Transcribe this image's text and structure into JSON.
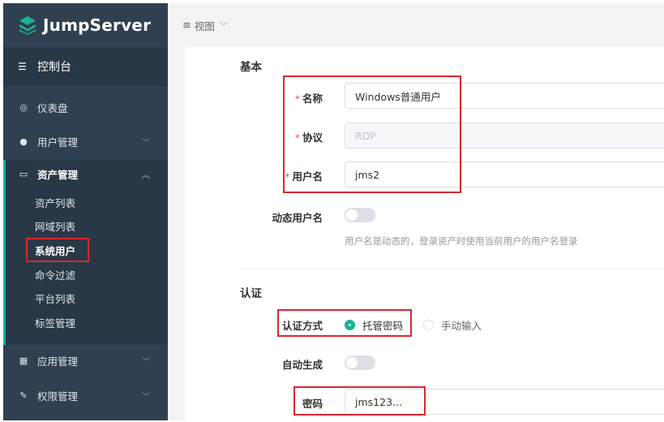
{
  "brand": {
    "name": "JumpServer",
    "accent": "#1ab394",
    "sidebar_bg": "#2f4050",
    "highlight": "#d9282f"
  },
  "sidebar": {
    "console_label": "控制台",
    "items": [
      {
        "label": "仪表盘",
        "icon": "dashboard-icon"
      },
      {
        "label": "用户管理",
        "icon": "users-icon"
      },
      {
        "label": "资产管理",
        "icon": "inbox-icon"
      },
      {
        "label": "应用管理",
        "icon": "grid-icon"
      },
      {
        "label": "权限管理",
        "icon": "edit-icon"
      }
    ],
    "asset_sub_items": [
      "资产列表",
      "网域列表",
      "系统用户",
      "命令过滤",
      "平台列表",
      "标签管理"
    ]
  },
  "topbar": {
    "view_label": "视图"
  },
  "form": {
    "basic_section": "基本",
    "name_label": "名称",
    "name_value": "Windows普通用户",
    "protocol_label": "协议",
    "protocol_value": "RDP",
    "username_label": "用户名",
    "username_value": "jms2",
    "dynamic_username_label": "动态用户名",
    "dynamic_username_help": "用户名是动态的，登录资产时使用当前用户的用户名登录",
    "auth_section": "认证",
    "auth_method_label": "认证方式",
    "auth_options": [
      "托管密码",
      "手动输入"
    ],
    "auto_generate_label": "自动生成",
    "password_label": "密码",
    "password_value": "jms123..."
  }
}
